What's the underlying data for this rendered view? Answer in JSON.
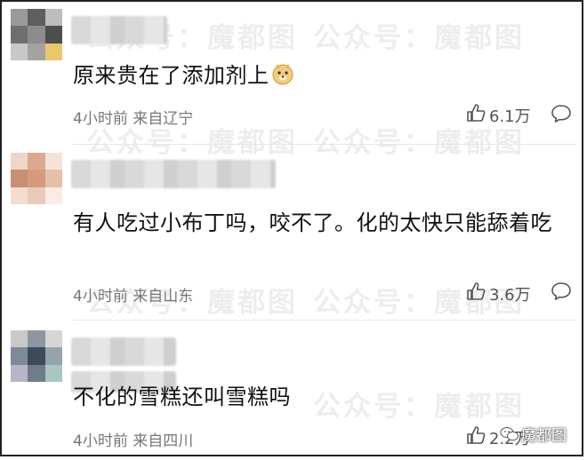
{
  "comments": [
    {
      "text": "原来贵在了添加剂上",
      "time": "4小时前",
      "location": "来自辽宁",
      "likes": "6.1万",
      "emoji": "doge-emoji"
    },
    {
      "text": "有人吃过小布丁吗，咬不了。化的太快只能舔着吃",
      "time": "4小时前",
      "location": "来自山东",
      "likes": "3.6万"
    },
    {
      "text": "不化的雪糕还叫雪糕吗",
      "time": "4小时前",
      "location": "来自四川",
      "likes": "2.2万"
    }
  ],
  "watermark": {
    "part1": "公众号：",
    "part2": "魔都图"
  },
  "corner_brand": "魔都图",
  "icons": {
    "like": "thumbs-up-icon",
    "reply": "comment-bubble-icon",
    "brand": "wechat-icon"
  }
}
